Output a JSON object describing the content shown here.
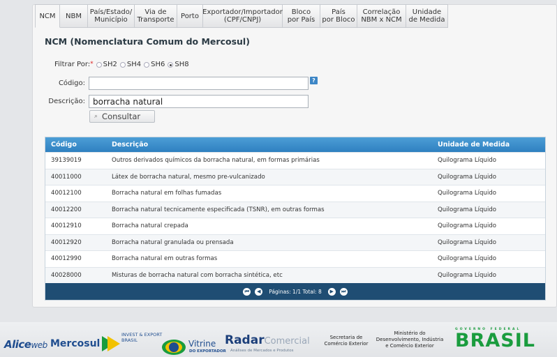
{
  "tabs": [
    {
      "label": "NCM",
      "active": true
    },
    {
      "label": "NBM"
    },
    {
      "label": "País/Estado/\nMunicípio"
    },
    {
      "label": "Via de\nTransporte"
    },
    {
      "label": "Porto"
    },
    {
      "label": "Exportador/Importador\n(CPF/CNPJ)"
    },
    {
      "label": "Bloco\npor País"
    },
    {
      "label": "País\npor Bloco"
    },
    {
      "label": "Correlação\nNBM x NCM"
    },
    {
      "label": "Unidade\nde Medida"
    }
  ],
  "page_title": "NCM (Nomenclatura Comum do Mercosul)",
  "filter": {
    "label": "Filtrar Por:",
    "required_mark": "*",
    "options": [
      "SH2",
      "SH4",
      "SH6",
      "SH8"
    ],
    "selected": "SH8"
  },
  "form": {
    "codigo_label": "Código:",
    "codigo_value": "",
    "help_icon": "?",
    "descricao_label": "Descrição:",
    "descricao_value": "borracha natural",
    "consultar_label": "Consultar"
  },
  "table": {
    "headers": [
      "Código",
      "Descrição",
      "Unidade de Medida"
    ],
    "rows": [
      [
        "39139019",
        "Outros derivados químicos da borracha natural, em formas primárias",
        "Quilograma Líquido"
      ],
      [
        "40011000",
        "Látex de borracha natural, mesmo pre-vulcanizado",
        "Quilograma Líquido"
      ],
      [
        "40012100",
        "Borracha natural em folhas fumadas",
        "Quilograma Líquido"
      ],
      [
        "40012200",
        "Borracha natural tecnicamente especificada (TSNR), em outras formas",
        "Quilograma Líquido"
      ],
      [
        "40012910",
        "Borracha natural crepada",
        "Quilograma Líquido"
      ],
      [
        "40012920",
        "Borracha natural granulada ou prensada",
        "Quilograma Líquido"
      ],
      [
        "40012990",
        "Borracha natural em outras formas",
        "Quilograma Líquido"
      ],
      [
        "40028000",
        "Misturas de borracha natural com borracha sintética, etc",
        "Quilograma Líquido"
      ]
    ],
    "pager_text": "Páginas: 1/1 Total: 8"
  },
  "footer": {
    "aliceweb": "Alice",
    "aliceweb_suffix": "web",
    "mercosul": "Mercosul",
    "invest_export": "INVEST & EXPORT\nBRASIL",
    "vitrine": "Vitrine",
    "vitrine_sub": "DO EXPORTADOR",
    "radar": "Radar",
    "radar_suffix": "Comercial",
    "radar_sub": "Análises de Mercados e Produtos",
    "secretaria": "Secretaria de\nComércio Exterior",
    "ministerio": "Ministério do\nDesenvolvimento, Indústria\ne Comércio Exterior",
    "gov_label": "GOVERNO FEDERAL",
    "brasil": "BRASIL",
    "colors": {
      "green": "#1a9c3e",
      "yellow": "#f2c200",
      "blue": "#1f4d8f",
      "dark_blue": "#1c3f7a"
    }
  }
}
